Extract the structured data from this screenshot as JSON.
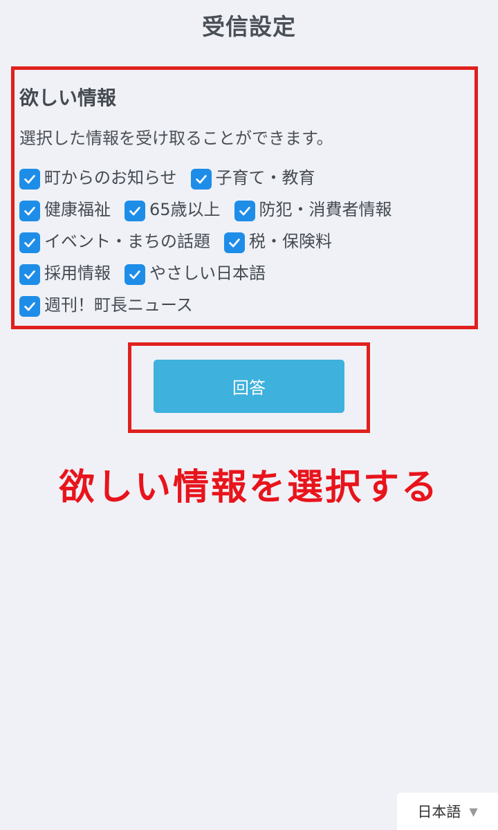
{
  "header": {
    "title": "受信設定"
  },
  "section": {
    "heading": "欲しい情報",
    "description": "選択した情報を受け取ることができます。",
    "options": [
      {
        "label": "町からのお知らせ",
        "checked": true
      },
      {
        "label": "子育て・教育",
        "checked": true
      },
      {
        "label": "健康福祉",
        "checked": true
      },
      {
        "label": "65歳以上",
        "checked": true
      },
      {
        "label": "防犯・消費者情報",
        "checked": true
      },
      {
        "label": "イベント・まちの話題",
        "checked": true
      },
      {
        "label": "税・保険料",
        "checked": true
      },
      {
        "label": "採用情報",
        "checked": true
      },
      {
        "label": "やさしい日本語",
        "checked": true
      },
      {
        "label": "週刊！町長ニュース",
        "checked": true
      }
    ]
  },
  "submit": {
    "label": "回答"
  },
  "annotation": {
    "text": "欲しい情報を選択する"
  },
  "language": {
    "selected": "日本語"
  },
  "colors": {
    "checkbox": "#1e8de8",
    "button": "#3eb1dd",
    "highlight": "#e0201e",
    "annotation": "#e8141c",
    "background": "#f0f1f6"
  }
}
